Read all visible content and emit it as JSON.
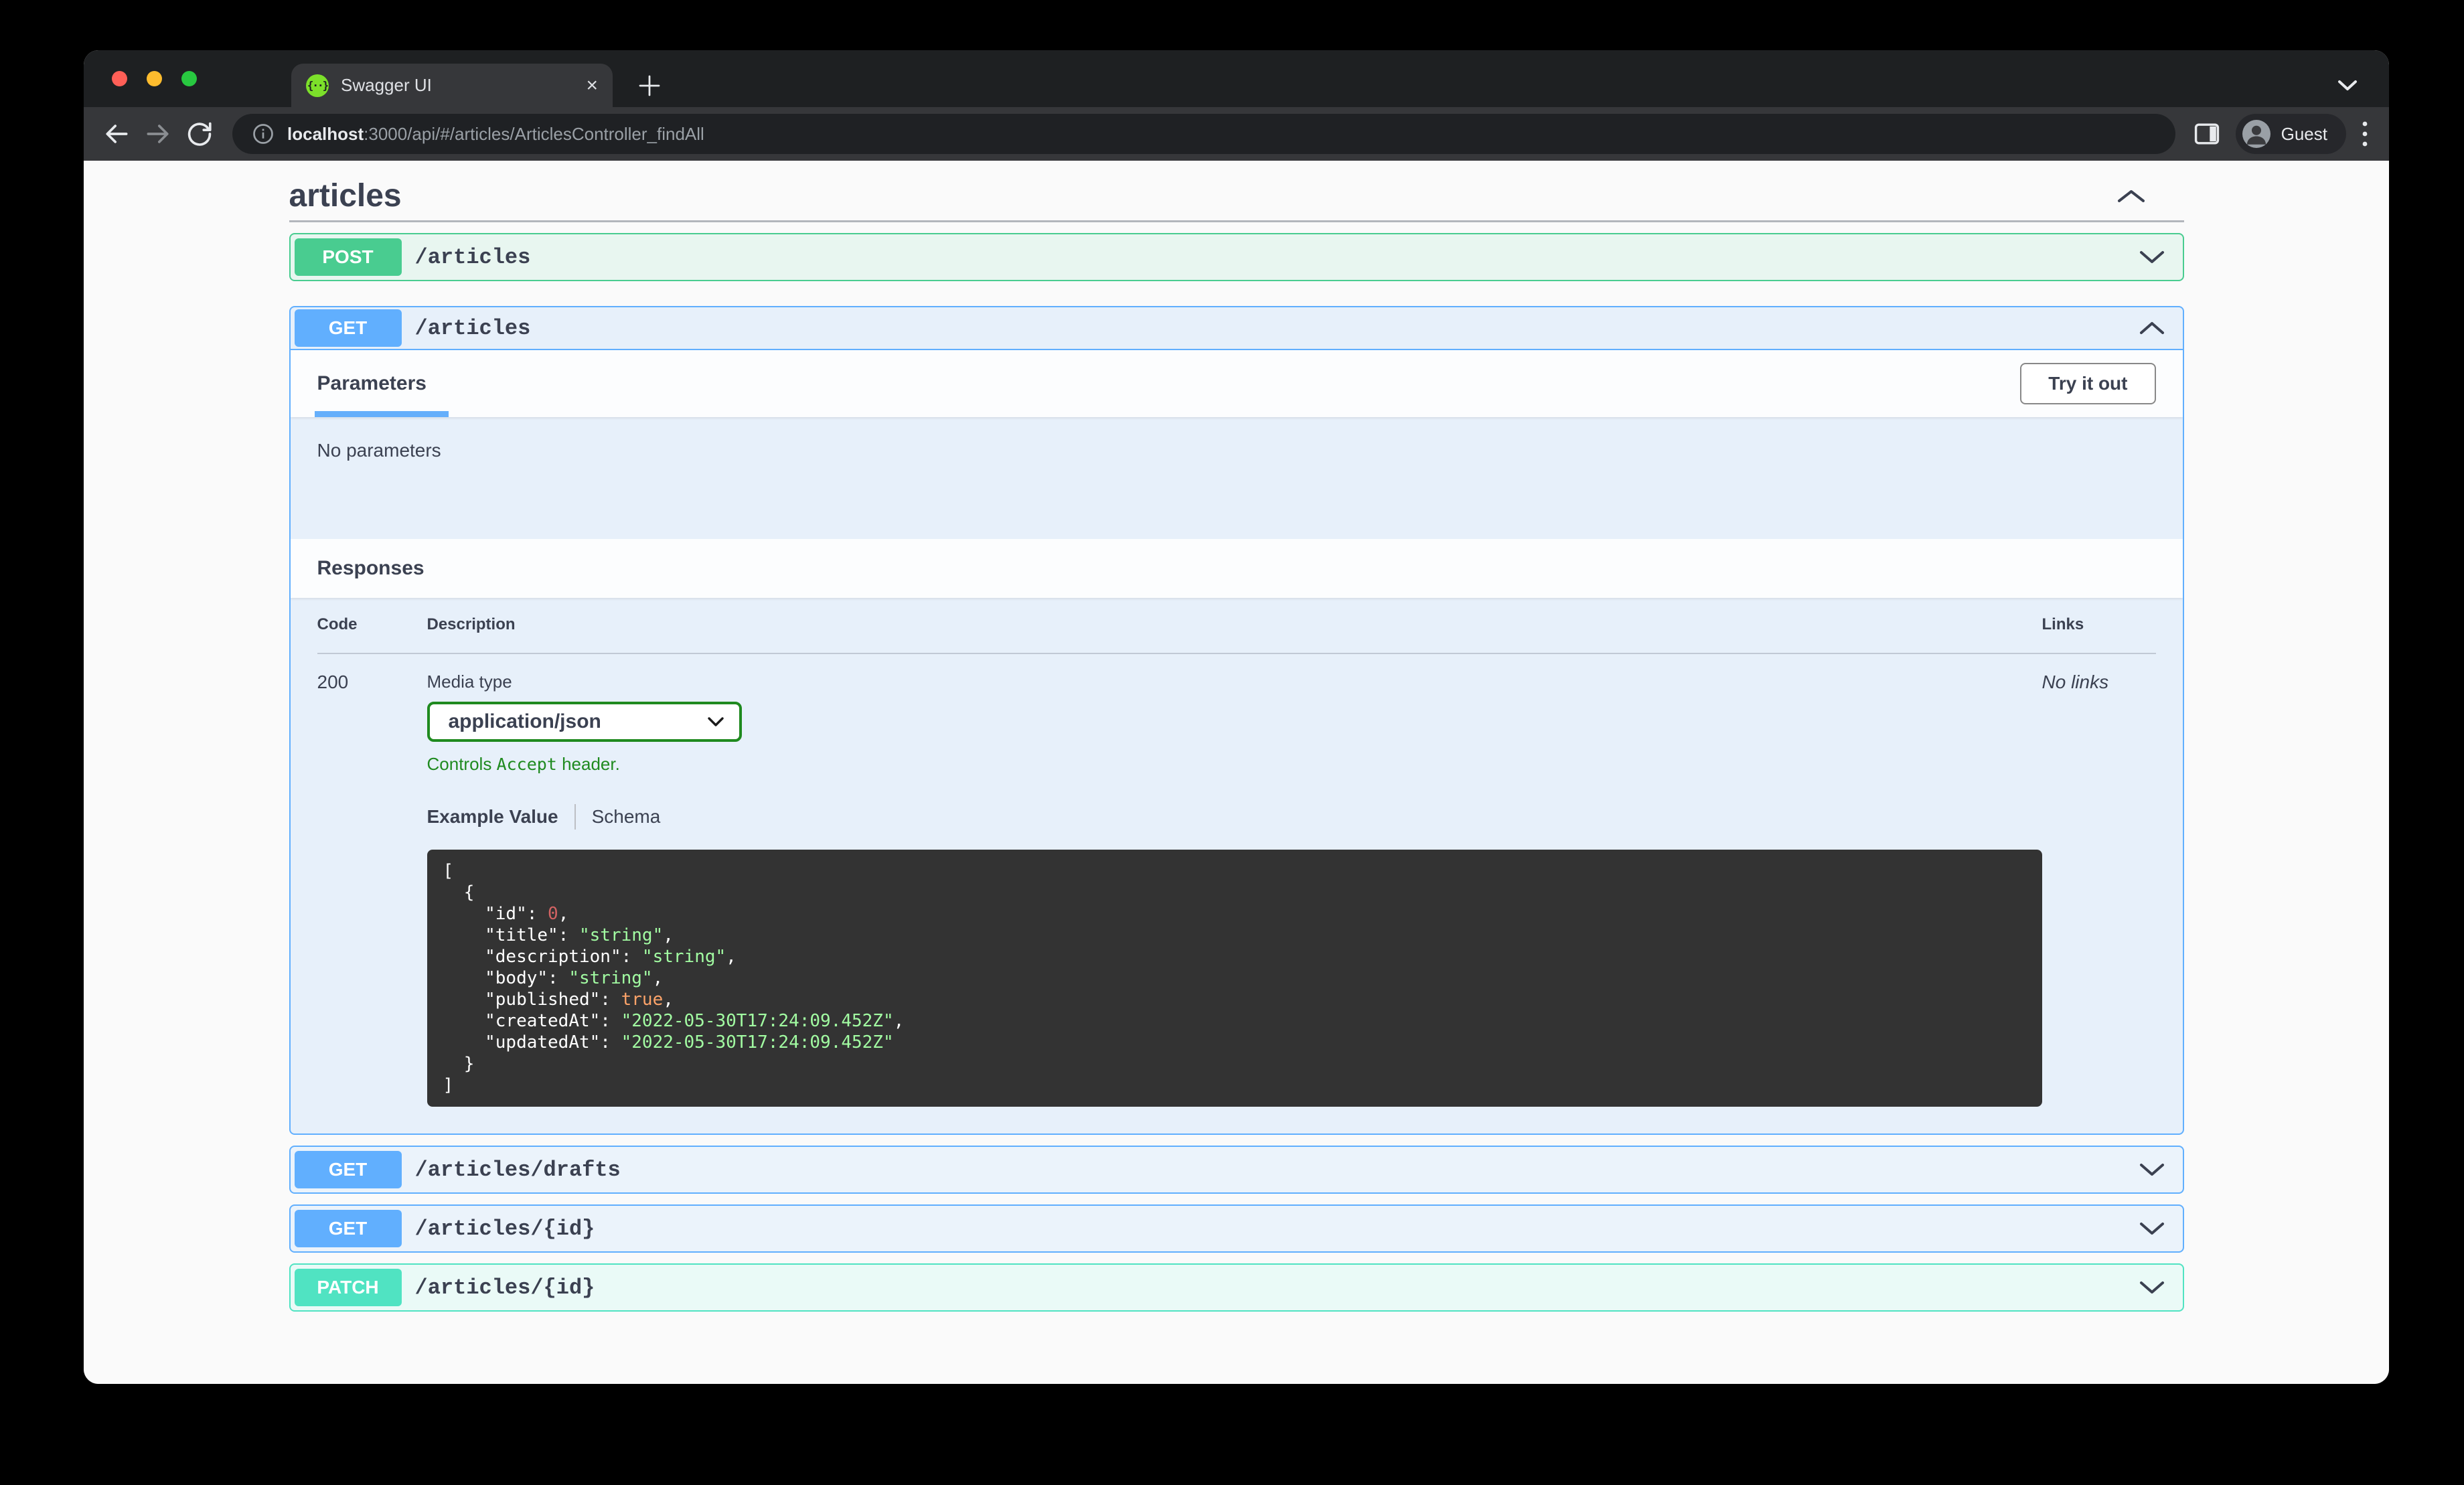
{
  "browser": {
    "tab": {
      "title": "Swagger UI",
      "close_glyph": "×"
    },
    "url": {
      "host": "localhost",
      "rest": ":3000/api/#/articles/ArticlesController_findAll"
    },
    "profile": {
      "label": "Guest"
    }
  },
  "swagger": {
    "section": {
      "title": "articles"
    },
    "post_row": {
      "method": "POST",
      "path": "/articles"
    },
    "get_block": {
      "method": "GET",
      "path": "/articles",
      "parameters_title": "Parameters",
      "try_it_out": "Try it out",
      "no_parameters": "No parameters",
      "responses_title": "Responses",
      "code_header": "Code",
      "description_header": "Description",
      "links_header": "Links",
      "status_code": "200",
      "media_type_label": "Media type",
      "media_type": "application/json",
      "hint": {
        "prefix": "Controls ",
        "code": "Accept",
        "suffix": " header."
      },
      "tab_example": "Example Value",
      "tab_schema": "Schema",
      "no_links": "No links"
    },
    "code_lines": {
      "l0": {
        "a": "["
      },
      "l1": {
        "a": "  {"
      },
      "l2": {
        "a": "    \"id\": ",
        "num": "0",
        "b": ","
      },
      "l3": {
        "a": "    \"title\": ",
        "str": "\"string\"",
        "b": ","
      },
      "l4": {
        "a": "    \"description\": ",
        "str": "\"string\"",
        "b": ","
      },
      "l5": {
        "a": "    \"body\": ",
        "str": "\"string\"",
        "b": ","
      },
      "l6": {
        "a": "    \"published\": ",
        "bool": "true",
        "b": ","
      },
      "l7": {
        "a": "    \"createdAt\": ",
        "str": "\"2022-05-30T17:24:09.452Z\"",
        "b": ","
      },
      "l8": {
        "a": "    \"updatedAt\": ",
        "str": "\"2022-05-30T17:24:09.452Z\""
      },
      "l9": {
        "a": "  }"
      },
      "l10": {
        "a": "]"
      }
    },
    "collapsed_rows": [
      {
        "method": "GET",
        "path": "/articles/drafts"
      },
      {
        "method": "GET",
        "path": "/articles/{id}"
      },
      {
        "method": "PATCH",
        "path": "/articles/{id}"
      }
    ]
  },
  "colors": {
    "get": "#61affe",
    "post": "#49cc90",
    "patch": "#50e3c2",
    "accent_green": "#1f8a1f",
    "code_bg": "#333333"
  }
}
